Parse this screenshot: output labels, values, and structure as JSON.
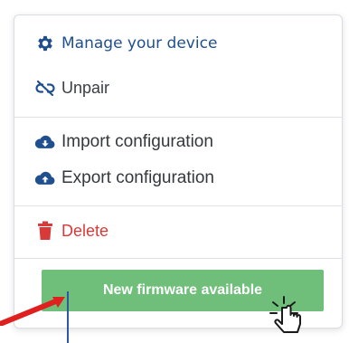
{
  "menu": {
    "manage": {
      "label": "Manage your device",
      "icon": "gear-icon"
    },
    "unpair": {
      "label": "Unpair",
      "icon": "broken-link-icon"
    },
    "import": {
      "label": "Import configuration",
      "icon": "cloud-download-icon"
    },
    "export": {
      "label": "Export configuration",
      "icon": "cloud-upload-icon"
    },
    "delete": {
      "label": "Delete",
      "icon": "trash-icon"
    }
  },
  "firmware_button": {
    "label": "New firmware available"
  },
  "colors": {
    "brand_blue": "#1f4f8f",
    "delete_red": "#d83a3a",
    "button_green": "#6fbf7a",
    "annotation_red": "#e0201e"
  }
}
